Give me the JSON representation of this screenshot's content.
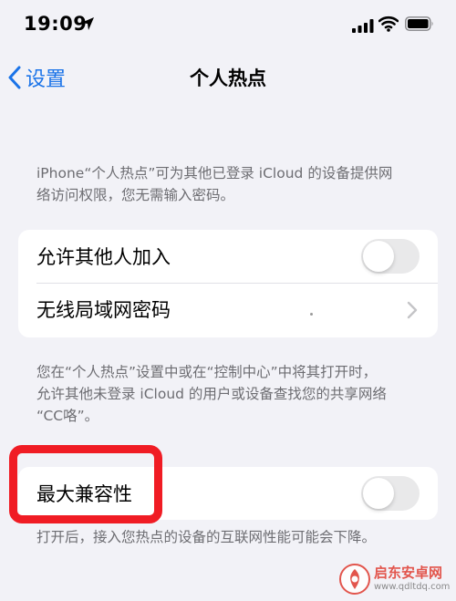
{
  "status_bar": {
    "time": "19:09"
  },
  "nav": {
    "back_label": "设置",
    "title": "个人热点"
  },
  "descriptions": {
    "intro_line1": "iPhone“个人热点”可为其他已登录 iCloud 的设备提供网",
    "intro_line2": "络访问权限，您无需输入密码。",
    "discover_line1": "您在“个人热点”设置中或在“控制中心”中将其打开时，",
    "discover_line2": "允许其他未登录 iCloud 的用户或设备查找您的共享网络",
    "discover_line3": "“CC咯”。",
    "compat_note": "打开后，接入您热点的设备的互联网性能可能会下降。"
  },
  "settings": {
    "allow_others": {
      "label": "允许其他人加入",
      "enabled": false
    },
    "wifi_password": {
      "label": "无线局域网密码"
    },
    "max_compat": {
      "label": "最大兼容性",
      "enabled": false
    }
  },
  "watermark": {
    "name": "启东安卓网",
    "url": "www.qdltdq.com"
  },
  "colors": {
    "accent": "#1a73e8",
    "highlight": "#f01c24",
    "background": "#f2f2f7",
    "toggle_off": "#e9e9ea"
  },
  "icons": [
    "location-arrow-icon",
    "signal-icon",
    "wifi-icon",
    "battery-icon",
    "chevron-left-icon",
    "chevron-right-icon",
    "watermark-logo-icon"
  ]
}
